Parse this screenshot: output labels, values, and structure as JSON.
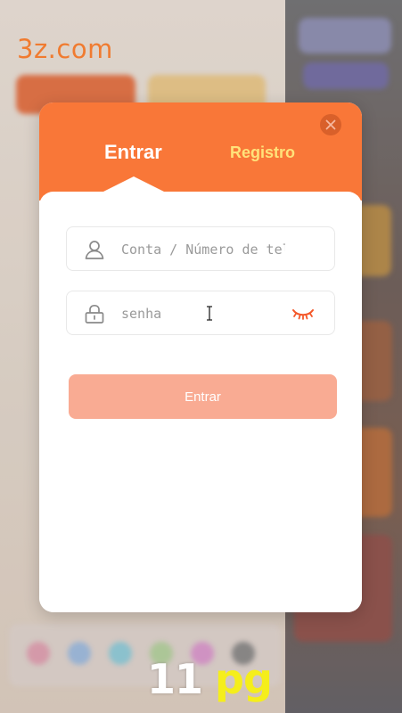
{
  "brand": {
    "text": "3z.com",
    "color": "#f07b30"
  },
  "modal": {
    "tabs": [
      {
        "label": "Entrar",
        "active": true
      },
      {
        "label": "Registro",
        "active": false
      }
    ],
    "close_icon": "close-icon",
    "account_field": {
      "icon": "user-icon",
      "placeholder": "Conta / Número de telefone",
      "value": ""
    },
    "password_field": {
      "icon": "lock-icon",
      "placeholder": "senha",
      "value": "",
      "visibility_icon": "eye-closed-icon"
    },
    "submit_label": "Entrar",
    "colors": {
      "header": "#f97738",
      "inactive_tab": "#ffe27a",
      "submit_disabled": "#f9ab93",
      "eye_icon": "#f4582a"
    }
  },
  "watermark": {
    "number": "11",
    "unit": "pg"
  }
}
